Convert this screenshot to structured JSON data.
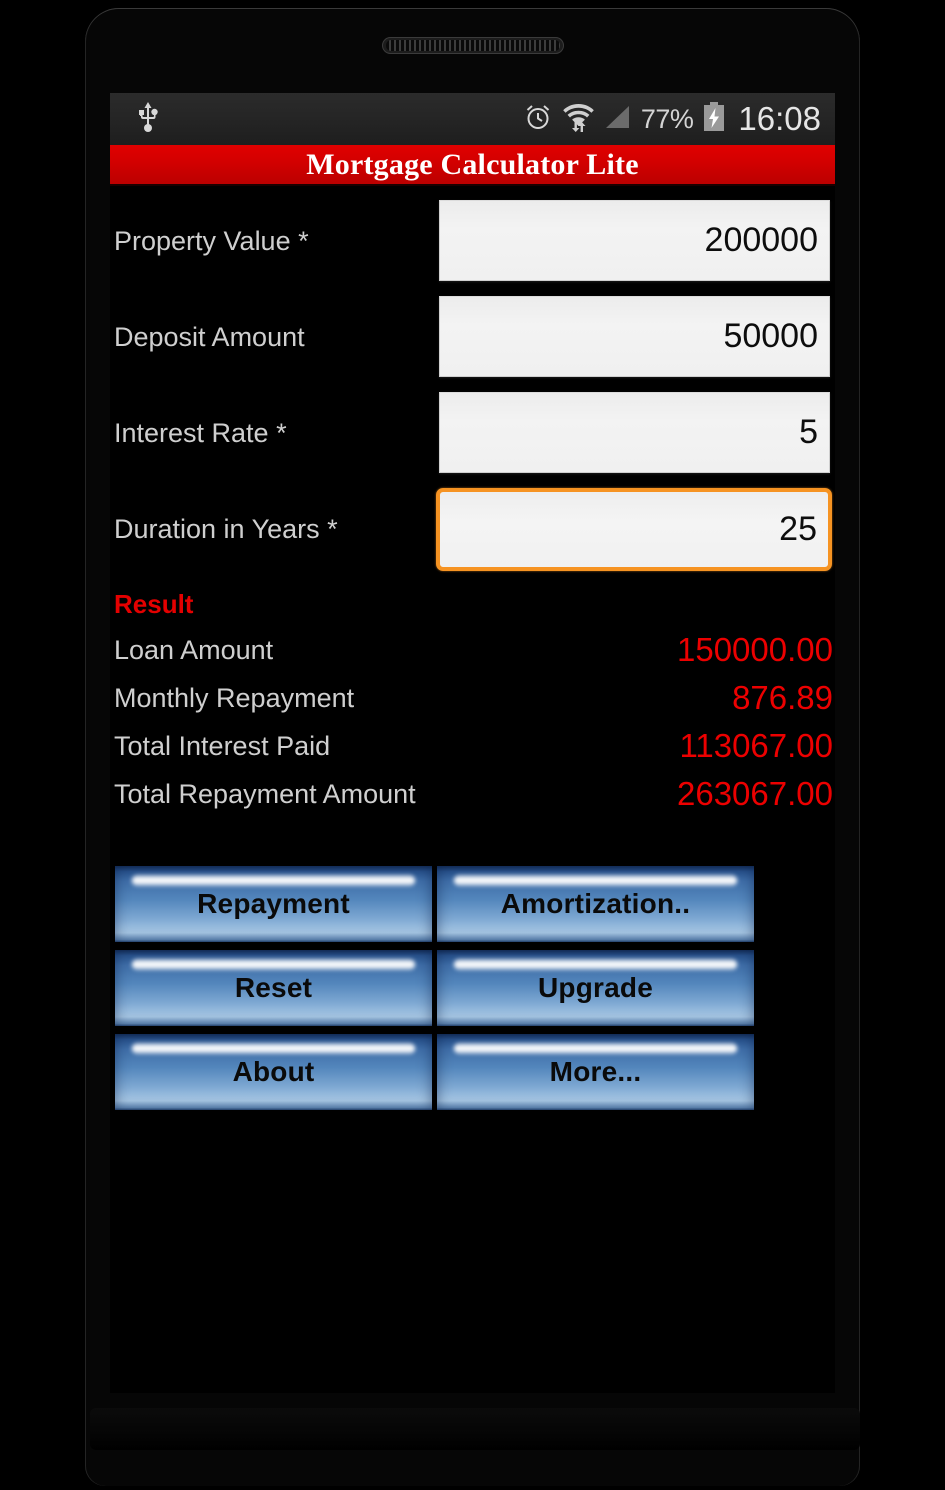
{
  "status_bar": {
    "usb_icon": "usb-icon",
    "alarm_icon": "alarm-clock-icon",
    "wifi_icon": "wifi-icon",
    "signal_icon": "signal-bars-icon",
    "battery_percent": "77%",
    "battery_icon": "battery-charging-icon",
    "clock": "16:08"
  },
  "title_bar": {
    "title": "Mortgage Calculator Lite",
    "background_color": "#d20000",
    "text_color": "#ffffff"
  },
  "form": {
    "fields": [
      {
        "label": "Property Value *",
        "value": "200000",
        "placeholder": "",
        "focused": false
      },
      {
        "label": "Deposit Amount",
        "value": "50000",
        "placeholder": "",
        "focused": false
      },
      {
        "label": "Interest Rate *",
        "value": "5",
        "placeholder": "",
        "focused": false
      },
      {
        "label": "Duration in Years *",
        "value": "25",
        "placeholder": "",
        "focused": true
      }
    ],
    "focus_border_color": "#f69322"
  },
  "result": {
    "heading": "Result",
    "heading_color": "#e40000",
    "value_color": "#ec0000",
    "rows": [
      {
        "label": "Loan Amount",
        "value": "150000.00"
      },
      {
        "label": "Monthly Repayment",
        "value": "876.89"
      },
      {
        "label": "Total Interest Paid",
        "value": "113067.00"
      },
      {
        "label": "Total Repayment Amount",
        "value": "263067.00"
      }
    ]
  },
  "buttons": {
    "rows": [
      [
        {
          "label": "Repayment"
        },
        {
          "label": "Amortization.."
        }
      ],
      [
        {
          "label": "Reset"
        },
        {
          "label": "Upgrade"
        }
      ],
      [
        {
          "label": "About"
        },
        {
          "label": "More..."
        }
      ]
    ]
  }
}
